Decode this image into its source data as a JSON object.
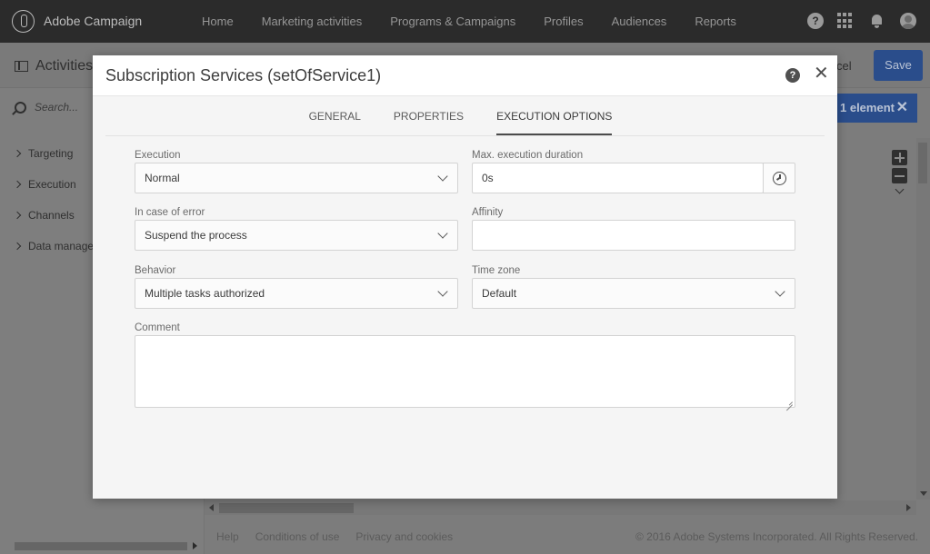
{
  "app": {
    "name": "Adobe Campaign",
    "nav": [
      "Home",
      "Marketing activities",
      "Programs & Campaigns",
      "Profiles",
      "Audiences",
      "Reports"
    ],
    "help_glyph": "?"
  },
  "background": {
    "page_title": "Activities",
    "cancel_label": "cel",
    "save_label": "Save",
    "search_placeholder": "Search...",
    "categories": [
      "Targeting",
      "Execution",
      "Channels",
      "Data managen"
    ],
    "selection_badge": "1 element",
    "selection_close": "✕",
    "footer_links": [
      "Help",
      "Conditions of use",
      "Privacy and cookies"
    ],
    "copyright": "© 2016 Adobe Systems Incorporated. All Rights Reserved."
  },
  "modal": {
    "title": "Subscription Services (setOfService1)",
    "help_glyph": "?",
    "close_glyph": "✕",
    "tabs": [
      "GENERAL",
      "PROPERTIES",
      "EXECUTION OPTIONS"
    ],
    "active_tab": "EXECUTION OPTIONS",
    "fields": {
      "execution": {
        "label": "Execution",
        "value": "Normal"
      },
      "max_duration": {
        "label": "Max. execution duration",
        "value": "0s"
      },
      "in_case_of_error": {
        "label": "In case of error",
        "value": "Suspend the process"
      },
      "affinity": {
        "label": "Affinity",
        "value": ""
      },
      "behavior": {
        "label": "Behavior",
        "value": "Multiple tasks authorized"
      },
      "time_zone": {
        "label": "Time zone",
        "value": "Default"
      },
      "comment": {
        "label": "Comment",
        "value": ""
      }
    }
  },
  "colors": {
    "topbar": "#2b2b2b",
    "primary_button": "#2a4d8b",
    "modal_bg": "#f5f5f5",
    "overlay": "#7c7c7c"
  },
  "icons": {
    "logo": "adobe-campaign-logo-icon",
    "help": "help-icon",
    "apps": "apps-grid-icon",
    "notifications": "bell-icon",
    "user": "avatar-icon",
    "clock": "clock-icon",
    "close": "close-icon"
  }
}
